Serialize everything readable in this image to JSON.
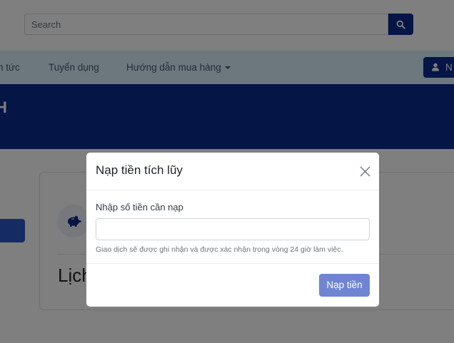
{
  "search": {
    "placeholder": "Search",
    "button_icon": "search-icon"
  },
  "nav": {
    "items": [
      {
        "label": "n tức"
      },
      {
        "label": "Tuyển dụng"
      },
      {
        "label": "Hướng dẫn mua hàng",
        "has_dropdown": true
      }
    ],
    "login": {
      "icon": "user-icon",
      "label": "N"
    }
  },
  "banner": {
    "title": "H"
  },
  "page": {
    "card_icon": "piggy-bank-icon",
    "history_heading": "Lịch"
  },
  "modal": {
    "title": "Nạp tiền tích lũy",
    "close_icon": "close-icon",
    "field_label": "Nhập số tiền cần nạp",
    "amount_value": "",
    "help_text": "Giao dịch sẽ được ghi nhận và được xác nhận trong vòng 24 giờ làm việc.",
    "submit_label": "Nạp tiền"
  },
  "colors": {
    "brand": "#0b2a8a",
    "nav_background": "#dbeefc",
    "submit_button": "#6f85d4",
    "backdrop": "rgba(0,0,0,0.5)"
  }
}
